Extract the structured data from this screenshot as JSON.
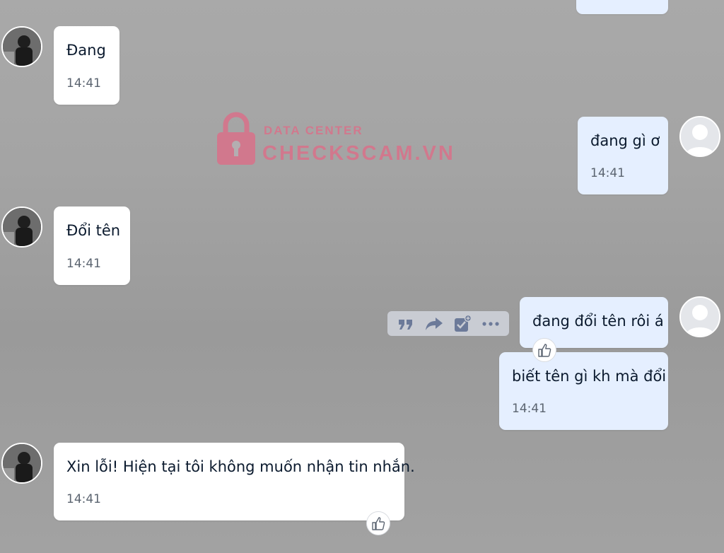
{
  "watermark": {
    "line1": "DATA CENTER",
    "line2": "CHECKSCAM.VN",
    "color": "#e06a86"
  },
  "colors": {
    "incoming_bubble": "#ffffff",
    "outgoing_bubble": "#e5efff",
    "text": "#0b1a2e",
    "time": "#5b6470"
  },
  "messages": [
    {
      "sender": "me",
      "text": "",
      "time": ""
    },
    {
      "sender": "friend",
      "text": "Đang",
      "time": "14:41"
    },
    {
      "sender": "me",
      "text": "đang gì ơ",
      "time": "14:41"
    },
    {
      "sender": "friend",
      "text": "Đổi tên",
      "time": "14:41"
    },
    {
      "sender": "me",
      "text": "đang đổi tên rôi á",
      "time": ""
    },
    {
      "sender": "me",
      "text": "biết tên gì kh mà đổi",
      "time": "14:41"
    },
    {
      "sender": "friend",
      "text": "Xin lỗi! Hiện tại tôi không muốn nhận tin nhắn.",
      "time": "14:41"
    }
  ],
  "toolbar": {
    "icons": [
      "quote-icon",
      "forward-icon",
      "add-task-icon",
      "more-icon"
    ]
  },
  "reactions": {
    "icon": "thumbs-up-icon"
  }
}
